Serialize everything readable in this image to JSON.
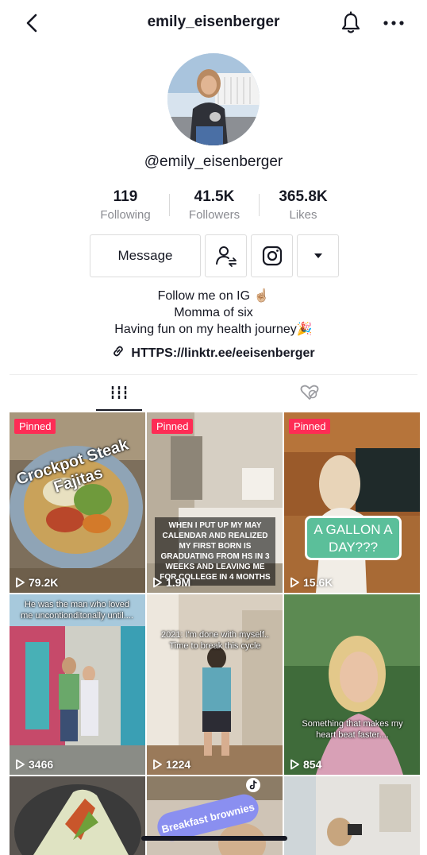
{
  "header": {
    "title": "emily_eisenberger",
    "back_icon": "chevron-left-icon",
    "bell_icon": "bell-icon",
    "more_icon": "more-dots-icon"
  },
  "profile": {
    "handle": "@emily_eisenberger",
    "stats": [
      {
        "value": "119",
        "label": "Following"
      },
      {
        "value": "41.5K",
        "label": "Followers"
      },
      {
        "value": "365.8K",
        "label": "Likes"
      }
    ],
    "buttons": {
      "message": "Message",
      "follow_icon": "user-swap-icon",
      "instagram_icon": "instagram-icon",
      "dropdown_icon": "triangle-down-icon"
    },
    "bio": [
      "Follow me on IG ☝🏼",
      "Momma of six",
      "Having fun on my health journey🎉"
    ],
    "link": "HTTPS://linktr.ee/eeisenberger"
  },
  "tabs": {
    "videos_icon": "grid-bars-icon",
    "liked_icon": "hidden-heart-icon"
  },
  "videos": [
    {
      "pinned": "Pinned",
      "views": "79.2K",
      "caption": "Crockpot Steak Fajitas"
    },
    {
      "pinned": "Pinned",
      "views": "1.9M",
      "caption": "WHEN I PUT UP MY MAY CALENDAR AND REALIZED MY FIRST BORN IS GRADUATING FROM HS IN 3 WEEKS AND LEAVING ME FOR COLLEGE IN 4 MONTHS"
    },
    {
      "pinned": "Pinned",
      "views": "15.6K",
      "caption": "A GALLON A DAY???"
    },
    {
      "pinned": "",
      "views": "3466",
      "caption": "He was the man who loved me uncontionditonally until...."
    },
    {
      "pinned": "",
      "views": "1224",
      "caption": "2021: I'm done with myself.. Time to break this cycle"
    },
    {
      "pinned": "",
      "views": "854",
      "caption": "Something that makes my heart beat faster...."
    },
    {
      "pinned": "",
      "views": "",
      "caption": ""
    },
    {
      "pinned": "",
      "views": "",
      "caption": "Breakfast brownies"
    },
    {
      "pinned": "",
      "views": "",
      "caption": ""
    }
  ],
  "colors": {
    "pinned_bg": "#fe2c55",
    "text": "#161823",
    "muted": "#8a8b91"
  }
}
